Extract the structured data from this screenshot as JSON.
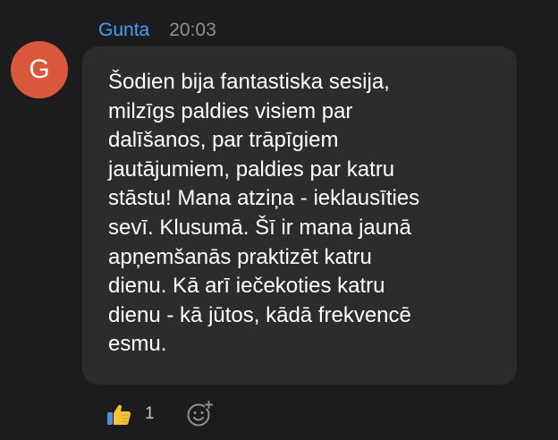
{
  "message": {
    "author": "Gunta",
    "time": "20:03",
    "avatar_initial": "G",
    "avatar_color": "#d9573b",
    "text": "Šodien bija fantastiska sesija,\nmilzīgs paldies visiem par\ndalīšanos, par trāpīgiem\njautājumiem, paldies par katru\nstāstu! Mana atziņa - ieklausīties\nsevī. Klusumā. Šī ir mana jaunā\napņemšanās praktizēt katru\ndienu. Kā arī iečekoties katru\ndienu - kā jūtos, kādā frekvencē\nesmu."
  },
  "reactions": [
    {
      "icon": "thumbs-up-icon",
      "count": "1"
    }
  ],
  "add_reaction_icon": "add-reaction-icon",
  "colors": {
    "author": "#4a9ff5",
    "bubble": "#2c2c2e",
    "background": "#1c1c1e"
  }
}
